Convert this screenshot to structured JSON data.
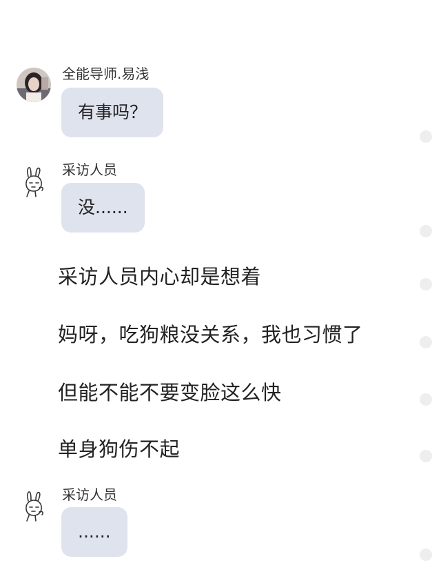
{
  "messages": [
    {
      "sender": "全能导师.易浅",
      "avatar_icon": "girl-photo-avatar-icon",
      "text": "有事吗？"
    },
    {
      "sender": "采访人员",
      "avatar_icon": "rabbit-sketch-avatar-icon",
      "text": "没......"
    }
  ],
  "narration": [
    "采访人员内心却是想着",
    "妈呀，吃狗粮没关系，我也习惯了",
    "但能不能不要变脸这么快",
    "单身狗伤不起"
  ],
  "last_message": {
    "sender": "采访人员",
    "avatar_icon": "rabbit-sketch-avatar-icon",
    "text": "......"
  },
  "colors": {
    "bubble": "#dfe3ee",
    "text": "#222222",
    "select_dot": "#eeeeee"
  },
  "selection_dot_icon": "radio-circle-icon"
}
